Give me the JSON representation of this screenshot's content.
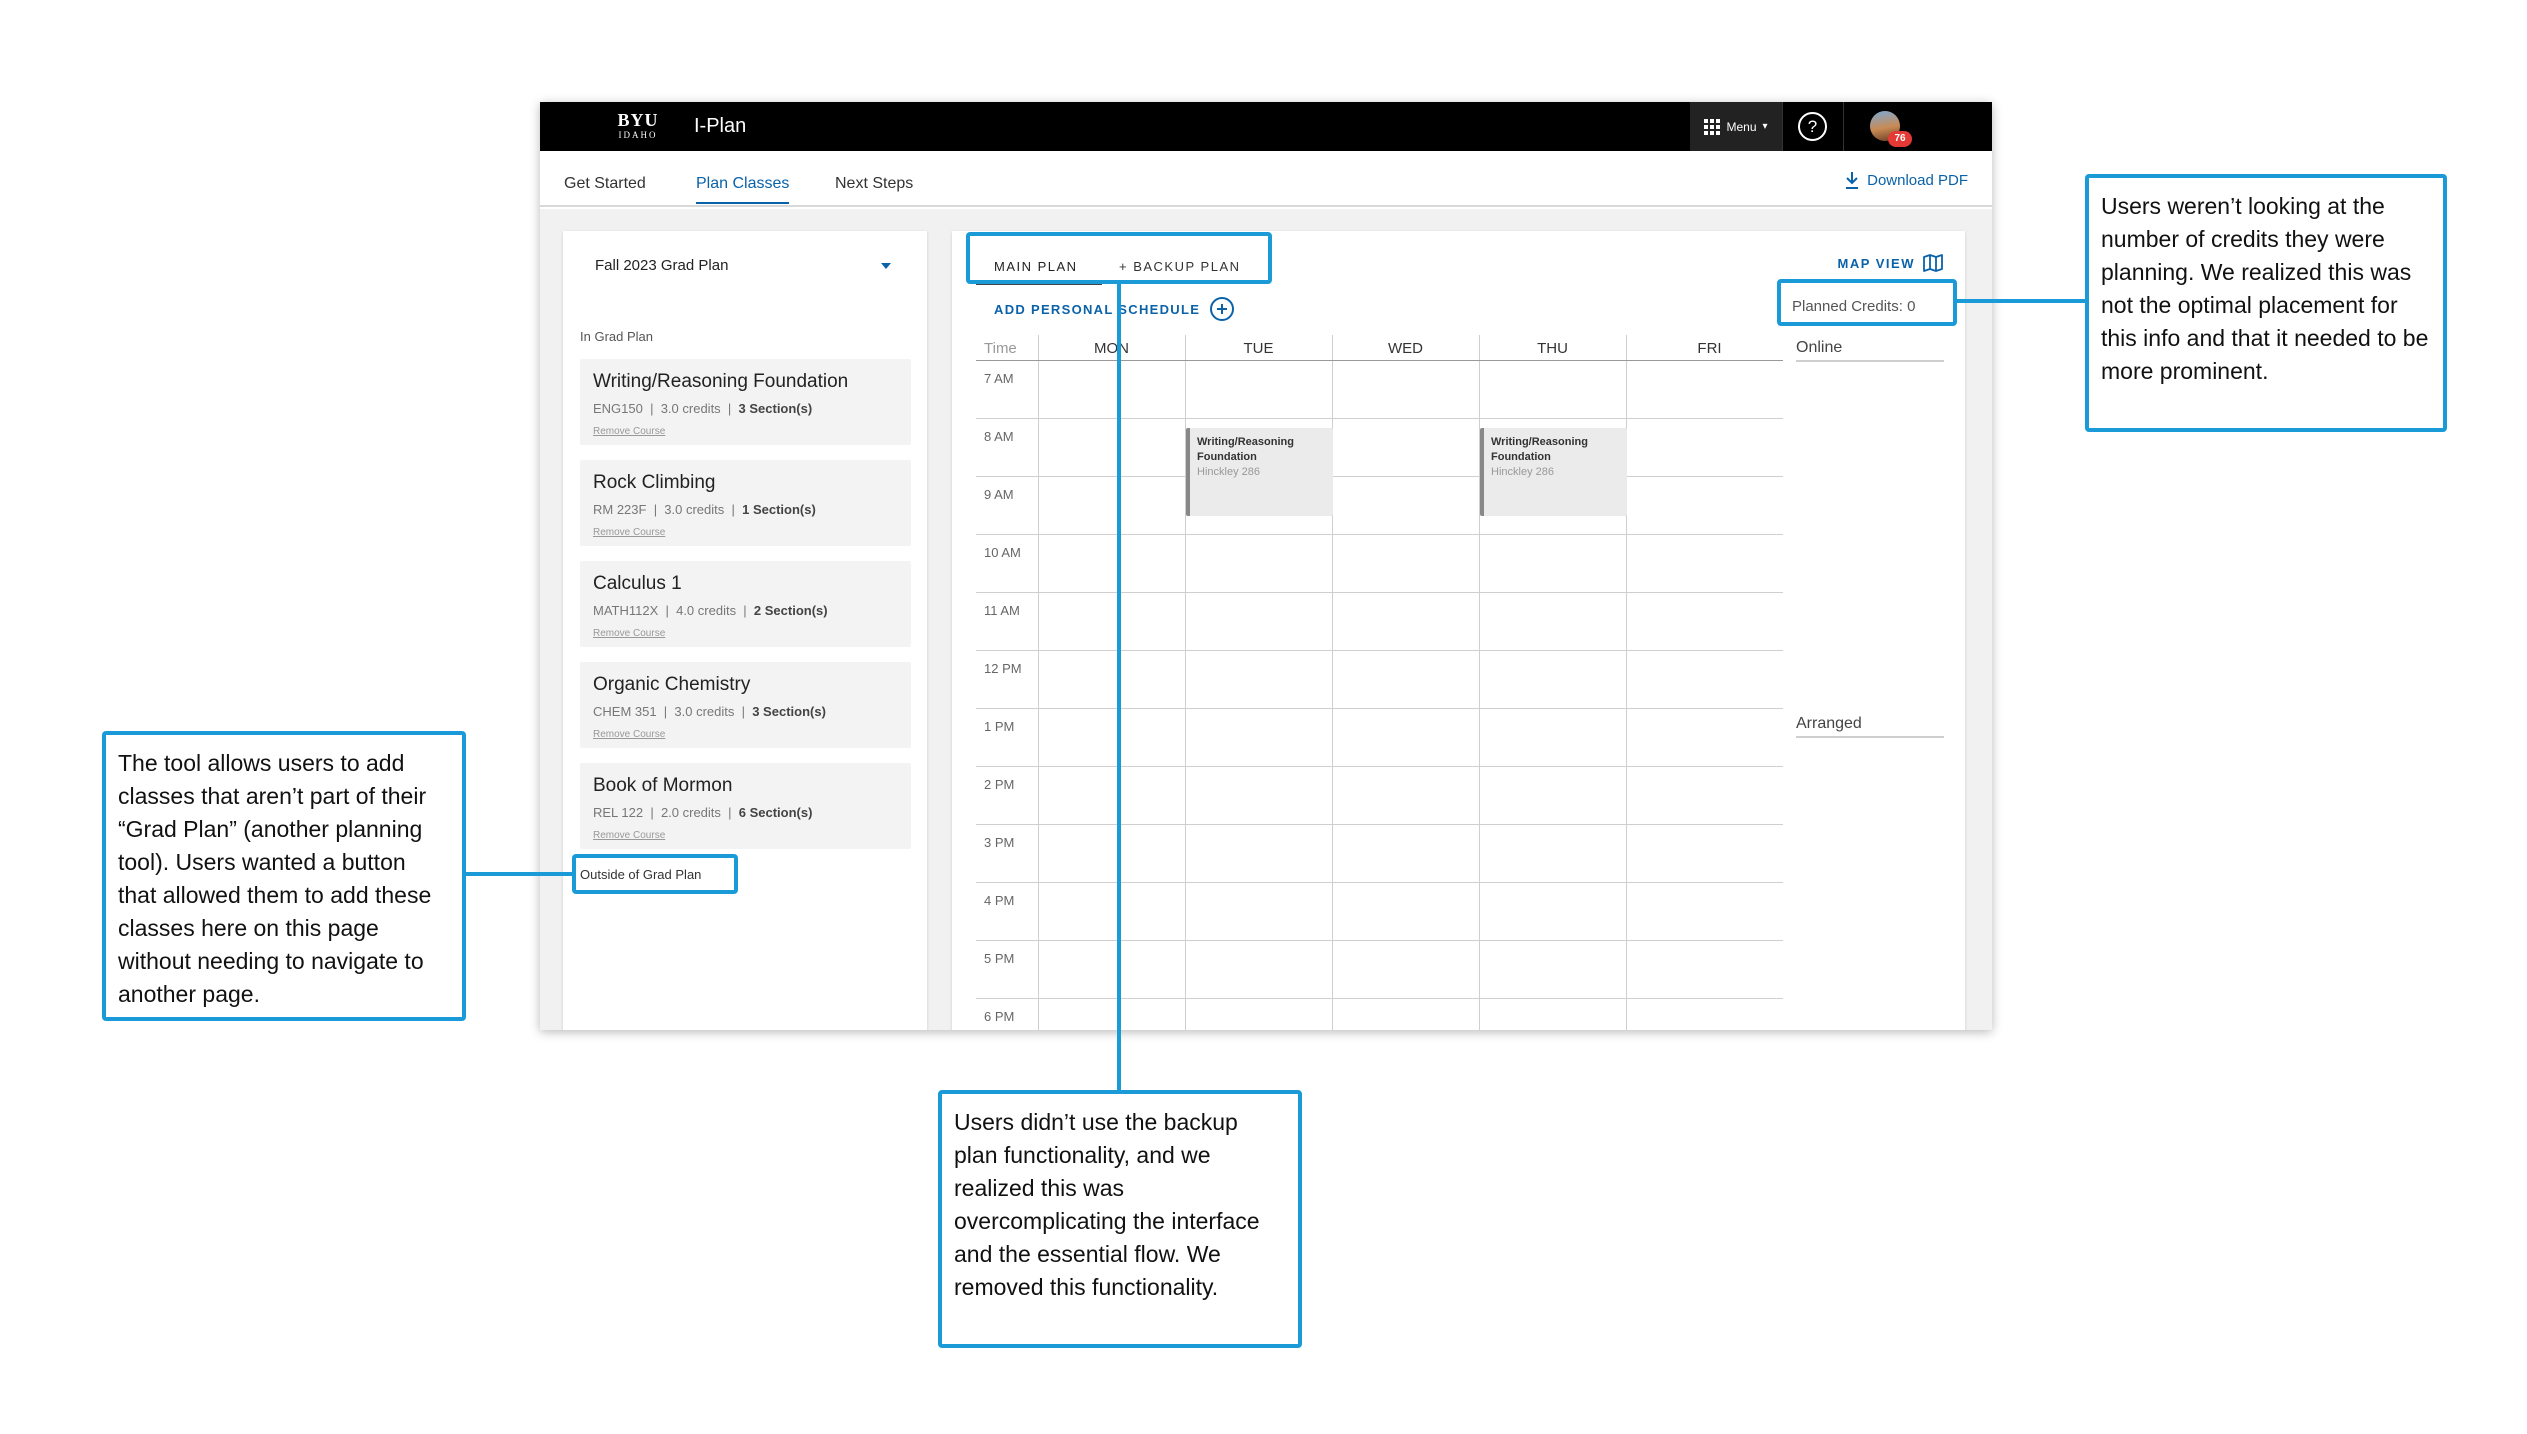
{
  "app": {
    "logo_top": "BYU",
    "logo_bottom": "IDAHO",
    "title": "I-Plan",
    "menu_label": "Menu",
    "help_label": "?",
    "notification_count": "76"
  },
  "tabs": [
    {
      "label": "Get Started"
    },
    {
      "label": "Plan Classes"
    },
    {
      "label": "Next Steps"
    }
  ],
  "download_label": "Download PDF",
  "left_panel": {
    "plan_select": "Fall 2023 Grad Plan",
    "section_label": "In Grad Plan",
    "courses": [
      {
        "name": "Writing/Reasoning Foundation",
        "code": "ENG150",
        "credits": "3.0 credits",
        "sections": "3 Section(s)",
        "remove": "Remove Course"
      },
      {
        "name": "Rock Climbing",
        "code": "RM 223F",
        "credits": "3.0 credits",
        "sections": "1 Section(s)",
        "remove": "Remove Course"
      },
      {
        "name": "Calculus 1",
        "code": "MATH112X",
        "credits": "4.0 credits",
        "sections": "2 Section(s)",
        "remove": "Remove Course"
      },
      {
        "name": "Organic Chemistry",
        "code": "CHEM 351",
        "credits": "3.0 credits",
        "sections": "3 Section(s)",
        "remove": "Remove Course"
      },
      {
        "name": "Book of Mormon",
        "code": "REL 122",
        "credits": "2.0 credits",
        "sections": "6 Section(s)",
        "remove": "Remove Course"
      }
    ],
    "outside_button": "Outside of Grad Plan"
  },
  "calendar": {
    "main_plan": "MAIN PLAN",
    "backup_plan": "+ BACKUP PLAN",
    "add_personal": "ADD PERSONAL SCHEDULE",
    "map_view": "MAP VIEW",
    "planned_credits": "Planned Credits:  0",
    "time_header": "Time",
    "days": [
      "MON",
      "TUE",
      "WED",
      "THU",
      "FRI"
    ],
    "times": [
      "7 AM",
      "8 AM",
      "9 AM",
      "10 AM",
      "11 AM",
      "12 PM",
      "1 PM",
      "2 PM",
      "3 PM",
      "4 PM",
      "5 PM",
      "6 PM"
    ],
    "events": [
      {
        "day": "TUE",
        "title": "Writing/Reasoning Foundation",
        "location": "Hinckley 286"
      },
      {
        "day": "THU",
        "title": "Writing/Reasoning Foundation",
        "location": "Hinckley 286"
      }
    ],
    "online_label": "Online",
    "arranged_label": "Arranged"
  },
  "annotations": {
    "credits": "Users weren’t looking at the number of credits they were planning. We realized this was not the optimal placement for this info and that it needed to be more prominent.",
    "outside": "The tool allows users to add classes that aren’t part of their “Grad Plan” (another planning tool). Users wanted a button that allowed them to add these classes here on this page without needing to navigate to another page.",
    "backup": "Users didn’t use the backup plan functionality, and we realized this was overcomplicating the interface and the essential flow. We removed this functionality."
  },
  "colors": {
    "accent": "#0a62a9",
    "annotation": "#1a9bd7",
    "topbar": "#000000",
    "badge": "#e53935"
  }
}
